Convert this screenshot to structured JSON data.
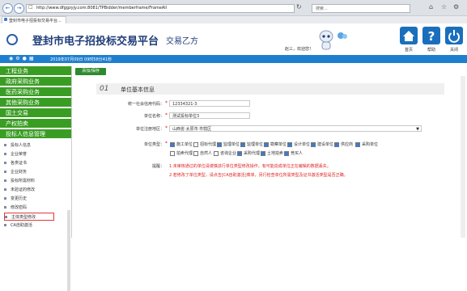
{
  "browser": {
    "url": "http://www.dfggzyjy.com:8081/TPBidder/memberframe/FrameAll",
    "search_placeholder": "搜索...",
    "tab_title": "登封市电子招投标交易平台..."
  },
  "header": {
    "title": "登封市电子招投标交易平台",
    "subtitle": "交易乙方",
    "welcome": "赵三，欢迎您！",
    "buttons": [
      {
        "label": "首页"
      },
      {
        "label": "帮助"
      },
      {
        "label": "关闭"
      }
    ],
    "icon_color": "#1a6fbd"
  },
  "status": {
    "datetime": "2019年07月09日 09时58分41秒"
  },
  "sidebar": {
    "menus": [
      {
        "label": "工程业务"
      },
      {
        "label": "政府采购业务"
      },
      {
        "label": "医药采购业务"
      },
      {
        "label": "其他采购业务"
      },
      {
        "label": "国土交易"
      },
      {
        "label": "产权拍卖"
      },
      {
        "label": "投标人信息管理"
      }
    ],
    "subitems": [
      {
        "label": "投标人信息"
      },
      {
        "label": "企业荣誉"
      },
      {
        "label": "各类证书"
      },
      {
        "label": "企业财务"
      },
      {
        "label": "投标所需材料"
      },
      {
        "label": "未验证的修改"
      },
      {
        "label": "变更历史"
      },
      {
        "label": "修改密码"
      },
      {
        "label": "主体类型修改"
      },
      {
        "label": "CA自助激活"
      }
    ],
    "active_index": 8,
    "accent": "#3a9d23"
  },
  "main": {
    "add_button": "添加/保存",
    "section_number": "01",
    "section_title": "单位基本信息",
    "form": {
      "credit_code_label": "统一社会信用代码：",
      "credit_code_value": "12334321-3",
      "name_label": "单位名称：",
      "name_value": "测试投标单位3",
      "region_label": "单位注册地区：",
      "region_value": "山西省·太原市·市辖区",
      "type_label": "单位类型：",
      "types_row1": [
        {
          "label": "施工单位",
          "checked": true
        },
        {
          "label": "招标代理",
          "checked": false
        },
        {
          "label": "监理单位",
          "checked": true
        },
        {
          "label": "监理单位",
          "checked": true
        },
        {
          "label": "勘察单位",
          "checked": true
        },
        {
          "label": "设计单位",
          "checked": true
        },
        {
          "label": "建设单位",
          "checked": true
        },
        {
          "label": "供应商",
          "checked": true
        },
        {
          "label": "采购单位",
          "checked": true
        }
      ],
      "types_row2": [
        {
          "label": "拍卖代理",
          "checked": false
        },
        {
          "label": "自然人",
          "checked": false
        },
        {
          "label": "咨询企业",
          "checked": false
        },
        {
          "label": "采购代理",
          "checked": true
        },
        {
          "label": "土地拍卖",
          "checked": true
        },
        {
          "label": "竞买人",
          "checked": true
        }
      ],
      "hint_label": "提醒：",
      "hint_1": "1.未审核通过的单位请谨慎进行单位类型修改操作，有可能造成单位正在编辑的数据丢失。",
      "hint_2": "2.若修改了单位类型，请点击[CA自助激活]菜单，另行检查单位所需类型及证书激活类型是否正确。"
    }
  }
}
